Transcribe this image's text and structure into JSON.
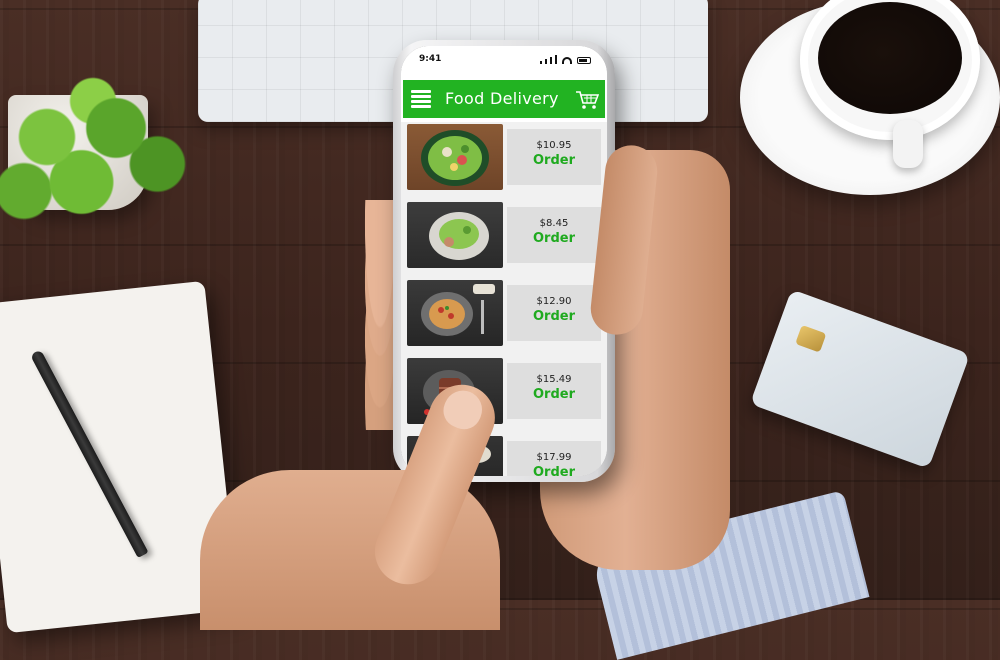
{
  "status_bar": {
    "time": "9:41"
  },
  "app": {
    "title": "Food Delivery",
    "menu_icon": "hamburger-menu-icon",
    "cart_icon": "shopping-cart-icon",
    "accent_color": "#22b322",
    "order_text_color": "#1faa1f"
  },
  "menu_items": [
    {
      "price": "$10.95",
      "order_label": "Order",
      "image": "salad-bowl"
    },
    {
      "price": "$8.45",
      "order_label": "Order",
      "image": "greens-plate"
    },
    {
      "price": "$12.90",
      "order_label": "Order",
      "image": "pizza"
    },
    {
      "price": "$15.49",
      "order_label": "Order",
      "image": "steak"
    },
    {
      "price": "$17.99",
      "order_label": "Order",
      "image": "vegetables"
    }
  ]
}
